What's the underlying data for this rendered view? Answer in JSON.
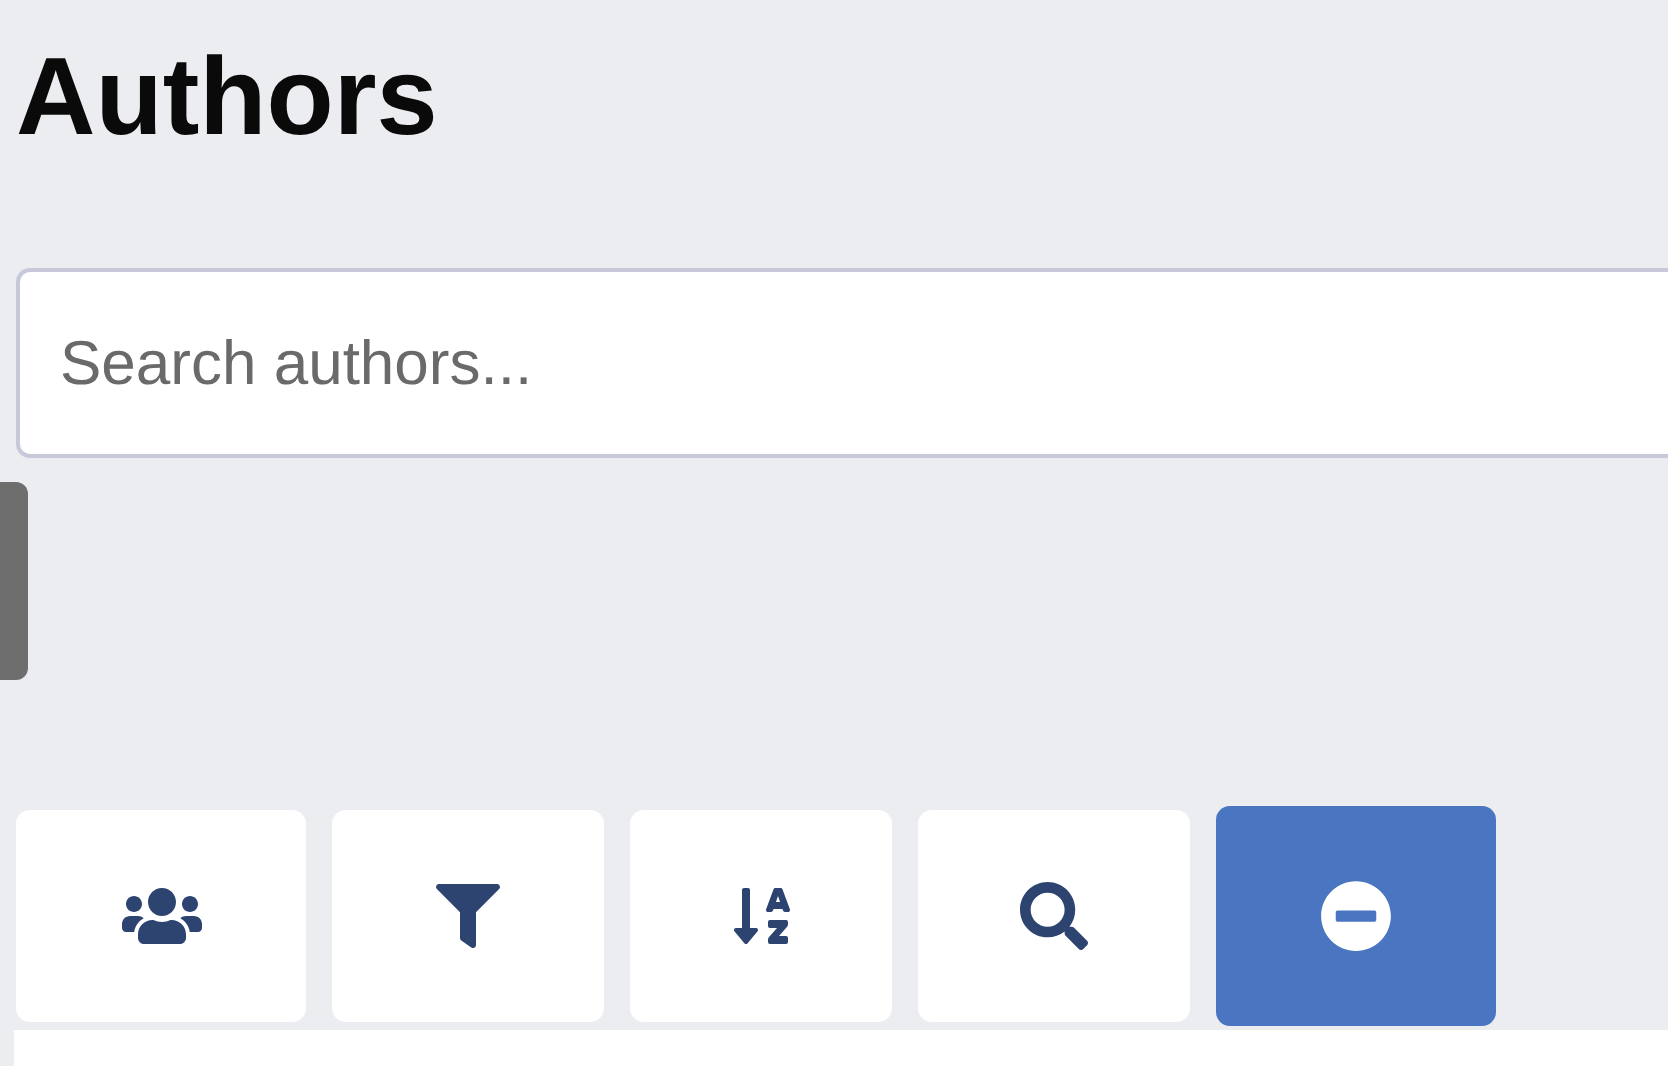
{
  "title": "Authors",
  "search": {
    "placeholder": "Search authors..."
  },
  "toolbar": [
    {
      "kind": "users",
      "selected": false
    },
    {
      "kind": "filter",
      "selected": false
    },
    {
      "kind": "sort",
      "selected": false
    },
    {
      "kind": "search",
      "selected": false
    },
    {
      "kind": "remove",
      "selected": true
    }
  ]
}
